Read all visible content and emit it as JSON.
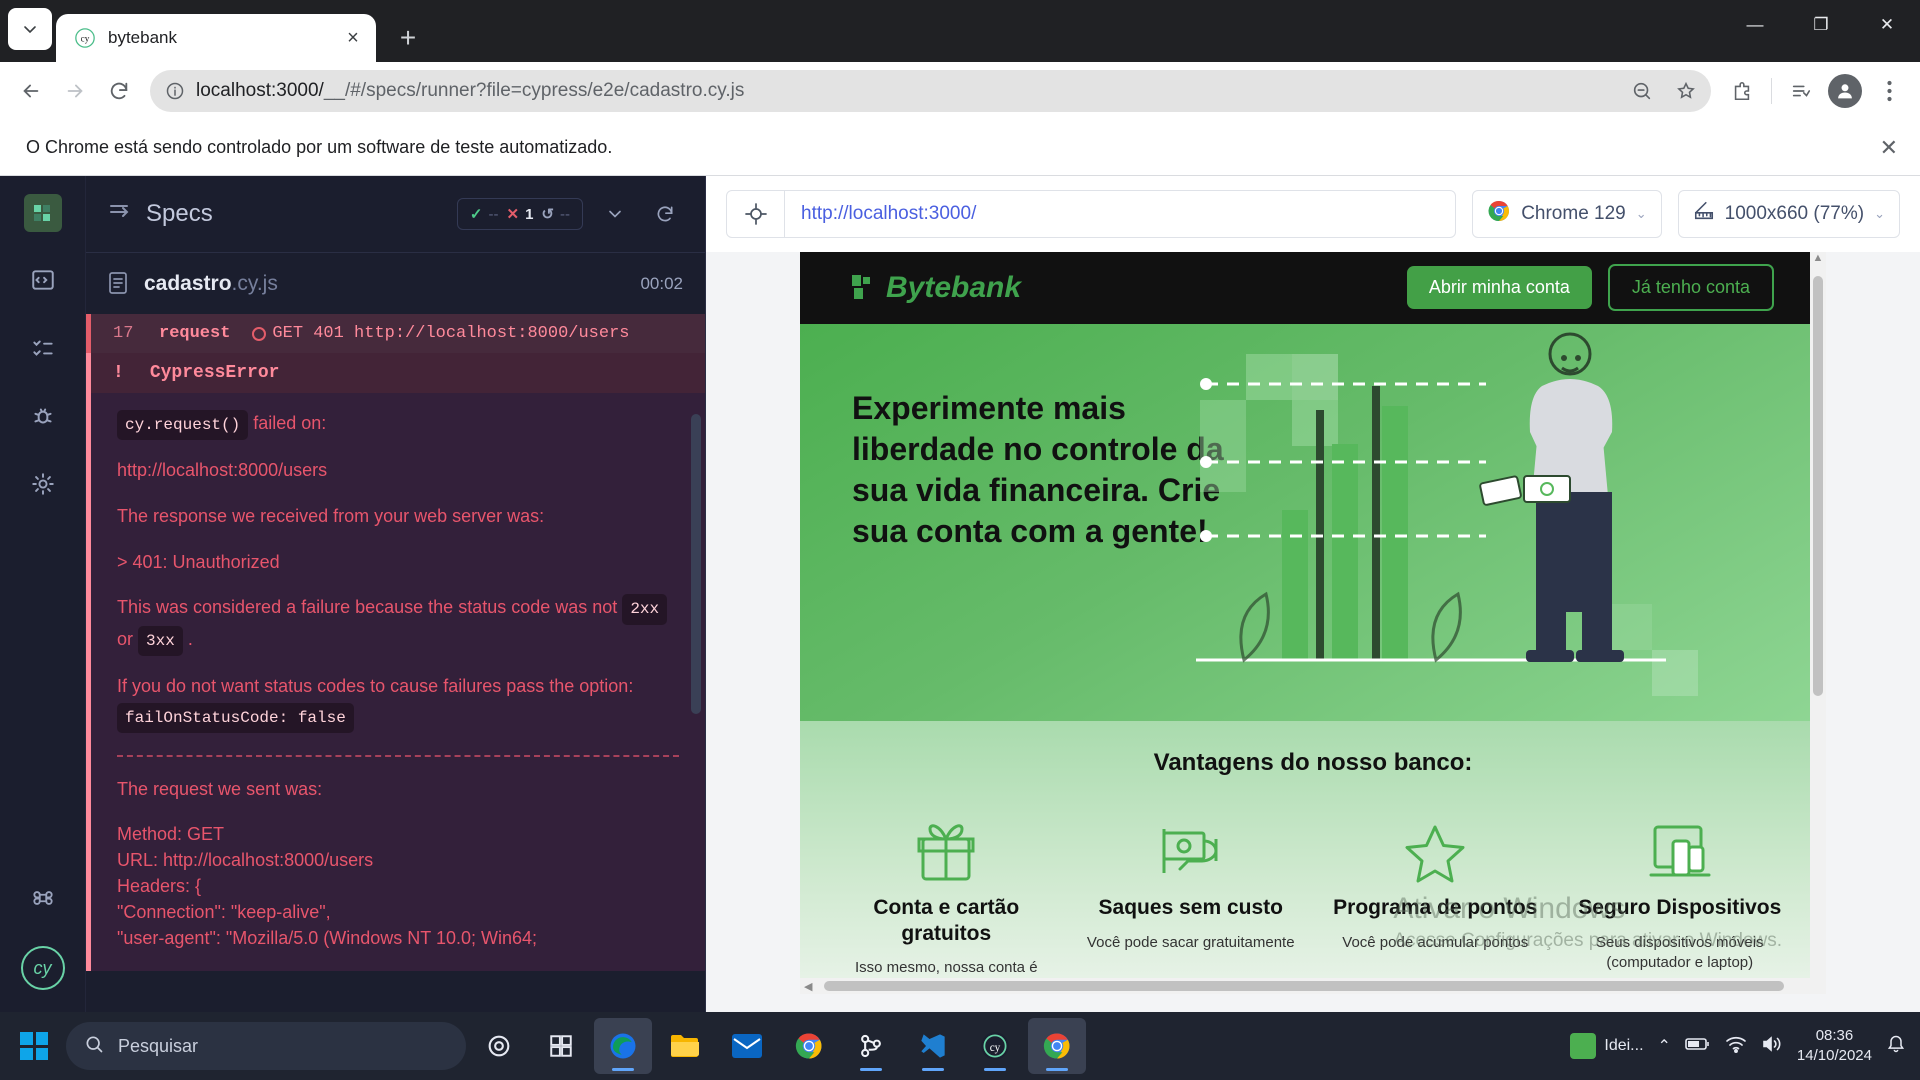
{
  "browser": {
    "tab": {
      "title": "bytebank",
      "favicon": "cypress-icon",
      "close": "×"
    },
    "new_tab_label": "+",
    "tab_search_icon": "chevron-down-icon",
    "window_controls": {
      "minimize": "—",
      "maximize": "❐",
      "close": "✕"
    },
    "nav": {
      "back": "←",
      "forward": "→",
      "reload": "⟳"
    },
    "omnibox": {
      "info_icon": "site-info-icon",
      "url_host": "localhost:3000/",
      "url_path": "__/#/specs/runner?file=cypress/e2e/cadastro.cy.js",
      "zoom_icon": "zoom-out-icon",
      "bookmark_icon": "star-icon",
      "extensions_icon": "extensions-icon",
      "readinglist_icon": "reading-list-icon",
      "profile_icon": "profile-avatar-icon",
      "menu_icon": "three-dot-menu-icon"
    },
    "infobar": {
      "message": "O Chrome está sendo controlado por um software de teste automatizado.",
      "close": "✕"
    }
  },
  "cypress": {
    "rail": {
      "logo": "cypress-app-logo",
      "items": [
        {
          "name": "specs-icon"
        },
        {
          "name": "runs-icon"
        },
        {
          "name": "debug-icon"
        },
        {
          "name": "settings-gear-icon"
        }
      ],
      "shortcut_icon": "command-key-icon",
      "brand_icon": "cypress-logo-icon"
    },
    "specs_header": {
      "menu_icon": "sidebar-toggle-icon",
      "title": "Specs",
      "stats": {
        "passed_icon": "✓",
        "passed": "--",
        "failed_icon": "✕",
        "failed": "1",
        "pending_icon": "↺",
        "pending": "--"
      },
      "collapse_icon": "chevron-down-icon",
      "reload_icon": "reload-icon"
    },
    "spec": {
      "file_icon": "file-icon",
      "name": "cadastro",
      "ext": ".cy.js",
      "duration": "00:02"
    },
    "command": {
      "number": "17",
      "name": "request",
      "status_icon": "failed-circle-icon",
      "message": "GET 401 http://localhost:8000/users"
    },
    "error": {
      "marker": "!",
      "title": "CypressError",
      "line1_code": "cy.request()",
      "line1_text": "failed on:",
      "url": "http://localhost:8000/users",
      "line3": "The response we received from your web server was:",
      "line4": "> 401: Unauthorized",
      "line5a": "This was considered a failure because the status code was not",
      "line5_code_a": "2xx",
      "line5_or": "or",
      "line5_code_b": "3xx",
      "line5_end": ".",
      "line6a": "If you do not want status codes to cause failures pass the option:",
      "line6_code": "failOnStatusCode: false",
      "divider": "----------------------------------------------------------------",
      "line7": "The request we sent was:",
      "req_method": "Method: GET",
      "req_url": "URL: http://localhost:8000/users",
      "req_headers": "Headers: {",
      "req_h1": "\"Connection\": \"keep-alive\",",
      "req_h2": "\"user-agent\": \"Mozilla/5.0 (Windows NT 10.0; Win64;"
    }
  },
  "preview": {
    "selector_icon": "selector-playground-icon",
    "url": "http://localhost:3000/",
    "browser_pill": {
      "icon": "chrome-icon",
      "label": "Chrome 129",
      "chevron": "⌄"
    },
    "viewport_pill": {
      "icon": "ruler-icon",
      "label": "1000x660 (77%)",
      "chevron": "⌄"
    }
  },
  "bytebank": {
    "logo": "Bytebank",
    "nav_buttons": [
      {
        "label": "Abrir minha conta",
        "style": "solid"
      },
      {
        "label": "Já tenho conta",
        "style": "ghost"
      }
    ],
    "hero_heading": "Experimente mais liberdade no controle da sua vida financeira. Crie sua conta com a gente!",
    "advantages_title": "Vantagens do nosso banco:",
    "cards": [
      {
        "icon": "gift-icon",
        "title": "Conta e cartão gratuitos",
        "text": "Isso mesmo, nossa conta é"
      },
      {
        "icon": "cash-hand-icon",
        "title": "Saques sem custo",
        "text": "Você pode sacar gratuitamente"
      },
      {
        "icon": "star-icon",
        "title": "Programa de pontos",
        "text": "Você pode acumular pontos"
      },
      {
        "icon": "devices-icon",
        "title": "Seguro Dispositivos",
        "text": "Seus dispositivos móveis (computador e laptop)"
      }
    ]
  },
  "windows_watermark": {
    "line1": "Ativar o Windows",
    "line2": "Acesse Configurações para ativar o Windows."
  },
  "taskbar": {
    "start_icon": "windows-start-icon",
    "search_placeholder": "Pesquisar",
    "search_icon": "search-icon",
    "items": [
      {
        "name": "task-view-icon"
      },
      {
        "name": "widgets-icon"
      },
      {
        "name": "edge-icon"
      },
      {
        "name": "file-explorer-icon"
      },
      {
        "name": "mail-icon"
      },
      {
        "name": "chrome-icon"
      },
      {
        "name": "git-icon"
      },
      {
        "name": "vscode-icon"
      },
      {
        "name": "cypress-icon"
      },
      {
        "name": "chrome-active-icon"
      }
    ],
    "tray": {
      "ideia_label": "Idei...",
      "chevron": "⌃",
      "battery_icon": "battery-icon",
      "network_icon": "wifi-icon",
      "volume_icon": "volume-icon",
      "time": "08:36",
      "date": "14/10/2024",
      "notification_icon": "notification-icon"
    }
  },
  "colors": {
    "cypress_green": "#69d3a7",
    "error_red": "#e8556c",
    "bytebank_green": "#4caf50",
    "accent_blue": "#4a5fe0"
  }
}
